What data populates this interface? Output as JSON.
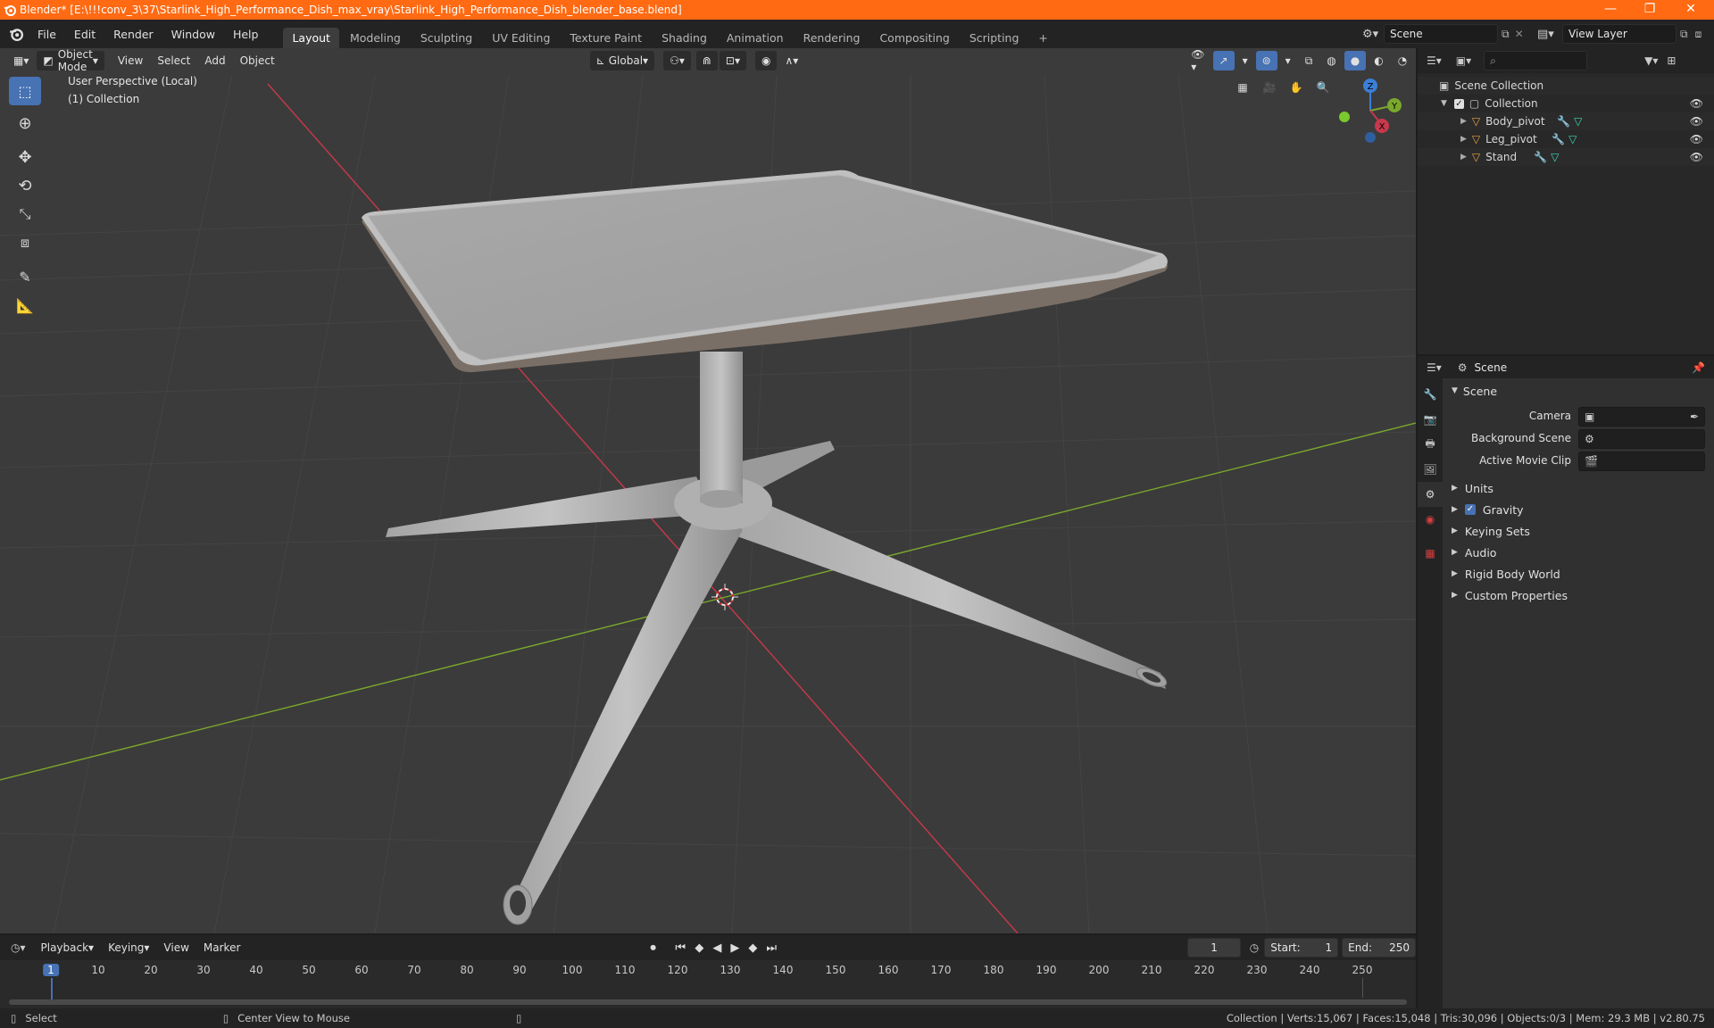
{
  "titlebar": {
    "title": "Blender* [E:\\!!!conv_3\\37\\Starlink_High_Performance_Dish_max_vray\\Starlink_High_Performance_Dish_blender_base.blend]",
    "minimize": "—",
    "restore": "❐",
    "close": "✕"
  },
  "menubar": {
    "menus": [
      "File",
      "Edit",
      "Render",
      "Window",
      "Help"
    ],
    "workspaces": [
      "Layout",
      "Modeling",
      "Sculpting",
      "UV Editing",
      "Texture Paint",
      "Shading",
      "Animation",
      "Rendering",
      "Compositing",
      "Scripting"
    ],
    "add_workspace": "+",
    "scene_label": "Scene",
    "view_layer_label": "View Layer"
  },
  "viewport": {
    "mode": "Object Mode",
    "menus": [
      "View",
      "Select",
      "Add",
      "Object"
    ],
    "orientation": "Global",
    "perspective_label": "User Perspective (Local)",
    "collection_label": "(1) Collection",
    "gizmo_axes": [
      "X",
      "Y",
      "Z"
    ]
  },
  "outliner": {
    "search_placeholder": "",
    "root": "Scene Collection",
    "collection": "Collection",
    "items": [
      {
        "name": "Body_pivot"
      },
      {
        "name": "Leg_pivot"
      },
      {
        "name": "Stand"
      }
    ]
  },
  "properties": {
    "context": "Scene",
    "panel_scene": "Scene",
    "camera_label": "Camera",
    "background_scene_label": "Background Scene",
    "active_movie_clip_label": "Active Movie Clip",
    "panels": [
      "Units",
      "Gravity",
      "Keying Sets",
      "Audio",
      "Rigid Body World",
      "Custom Properties"
    ],
    "gravity_checked": true
  },
  "timeline": {
    "menus": [
      "Playback",
      "Keying",
      "View",
      "Marker"
    ],
    "current_frame": "1",
    "start_label": "Start:",
    "start_value": "1",
    "end_label": "End:",
    "end_value": "250",
    "ticks": [
      "1",
      "10",
      "20",
      "30",
      "40",
      "50",
      "60",
      "70",
      "80",
      "90",
      "100",
      "110",
      "120",
      "130",
      "140",
      "150",
      "160",
      "170",
      "180",
      "190",
      "200",
      "210",
      "220",
      "230",
      "240",
      "250"
    ]
  },
  "statusbar": {
    "select": "Select",
    "center_view": "Center View to Mouse",
    "stats": "Collection | Verts:15,067 | Faces:15,048 | Tris:30,096 | Objects:0/3 | Mem: 29.3 MB | v2.80.75"
  },
  "colors": {
    "titlebar": "#ff6a13",
    "accent": "#4772b3",
    "x_axis": "#c9384c",
    "y_axis": "#7aa82c",
    "z_axis": "#3c7fd8"
  }
}
